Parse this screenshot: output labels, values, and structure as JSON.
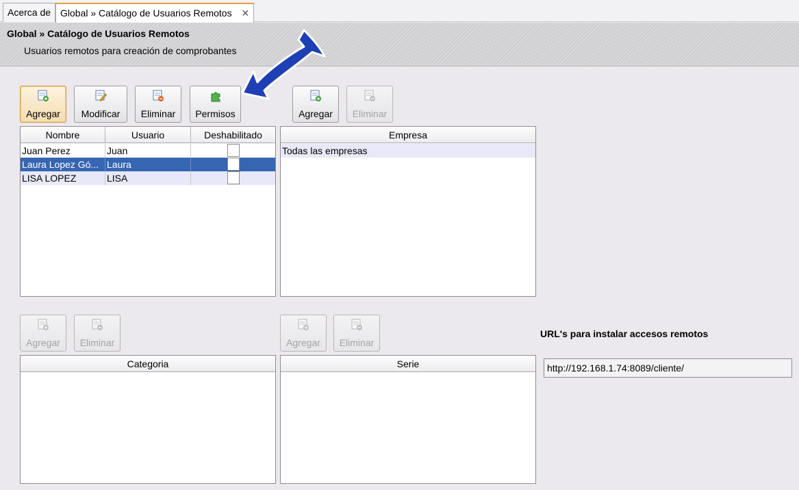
{
  "tabs": [
    {
      "label": "Acerca de"
    },
    {
      "label": "Global » Catálogo de Usuarios Remotos",
      "close": "✕"
    }
  ],
  "header": {
    "title": "Global » Catálogo de Usuarios Remotos",
    "subtitle": "Usuarios remotos para creación de comprobantes"
  },
  "users_toolbar": {
    "add": "Agregar",
    "modify": "Modificar",
    "delete": "Eliminar",
    "permissions": "Permisos"
  },
  "company_toolbar": {
    "add": "Agregar",
    "delete": "Eliminar"
  },
  "users_table": {
    "columns": [
      "Nombre",
      "Usuario",
      "Deshabilitado"
    ],
    "rows": [
      {
        "name": "Juan Perez",
        "user": "Juan",
        "disabled": false
      },
      {
        "name": "Laura Lopez Gó...",
        "user": "Laura",
        "disabled": false
      },
      {
        "name": "LISA LOPEZ",
        "user": "LISA",
        "disabled": false
      }
    ]
  },
  "company_table": {
    "columns": [
      "Empresa"
    ],
    "rows": [
      "Todas las empresas"
    ]
  },
  "category_toolbar": {
    "add": "Agregar",
    "delete": "Eliminar"
  },
  "category_table": {
    "columns": [
      "Categoria"
    ]
  },
  "series_toolbar": {
    "add": "Agregar",
    "delete": "Eliminar"
  },
  "series_table": {
    "columns": [
      "Serie"
    ]
  },
  "urls": {
    "label": "URL's para instalar accesos remotos",
    "value": "http://192.168.1.74:8089/cliente/"
  },
  "colors": {
    "accent": "#e7a03c",
    "selection": "#3666b2",
    "arrow": "#1f3fb5"
  }
}
